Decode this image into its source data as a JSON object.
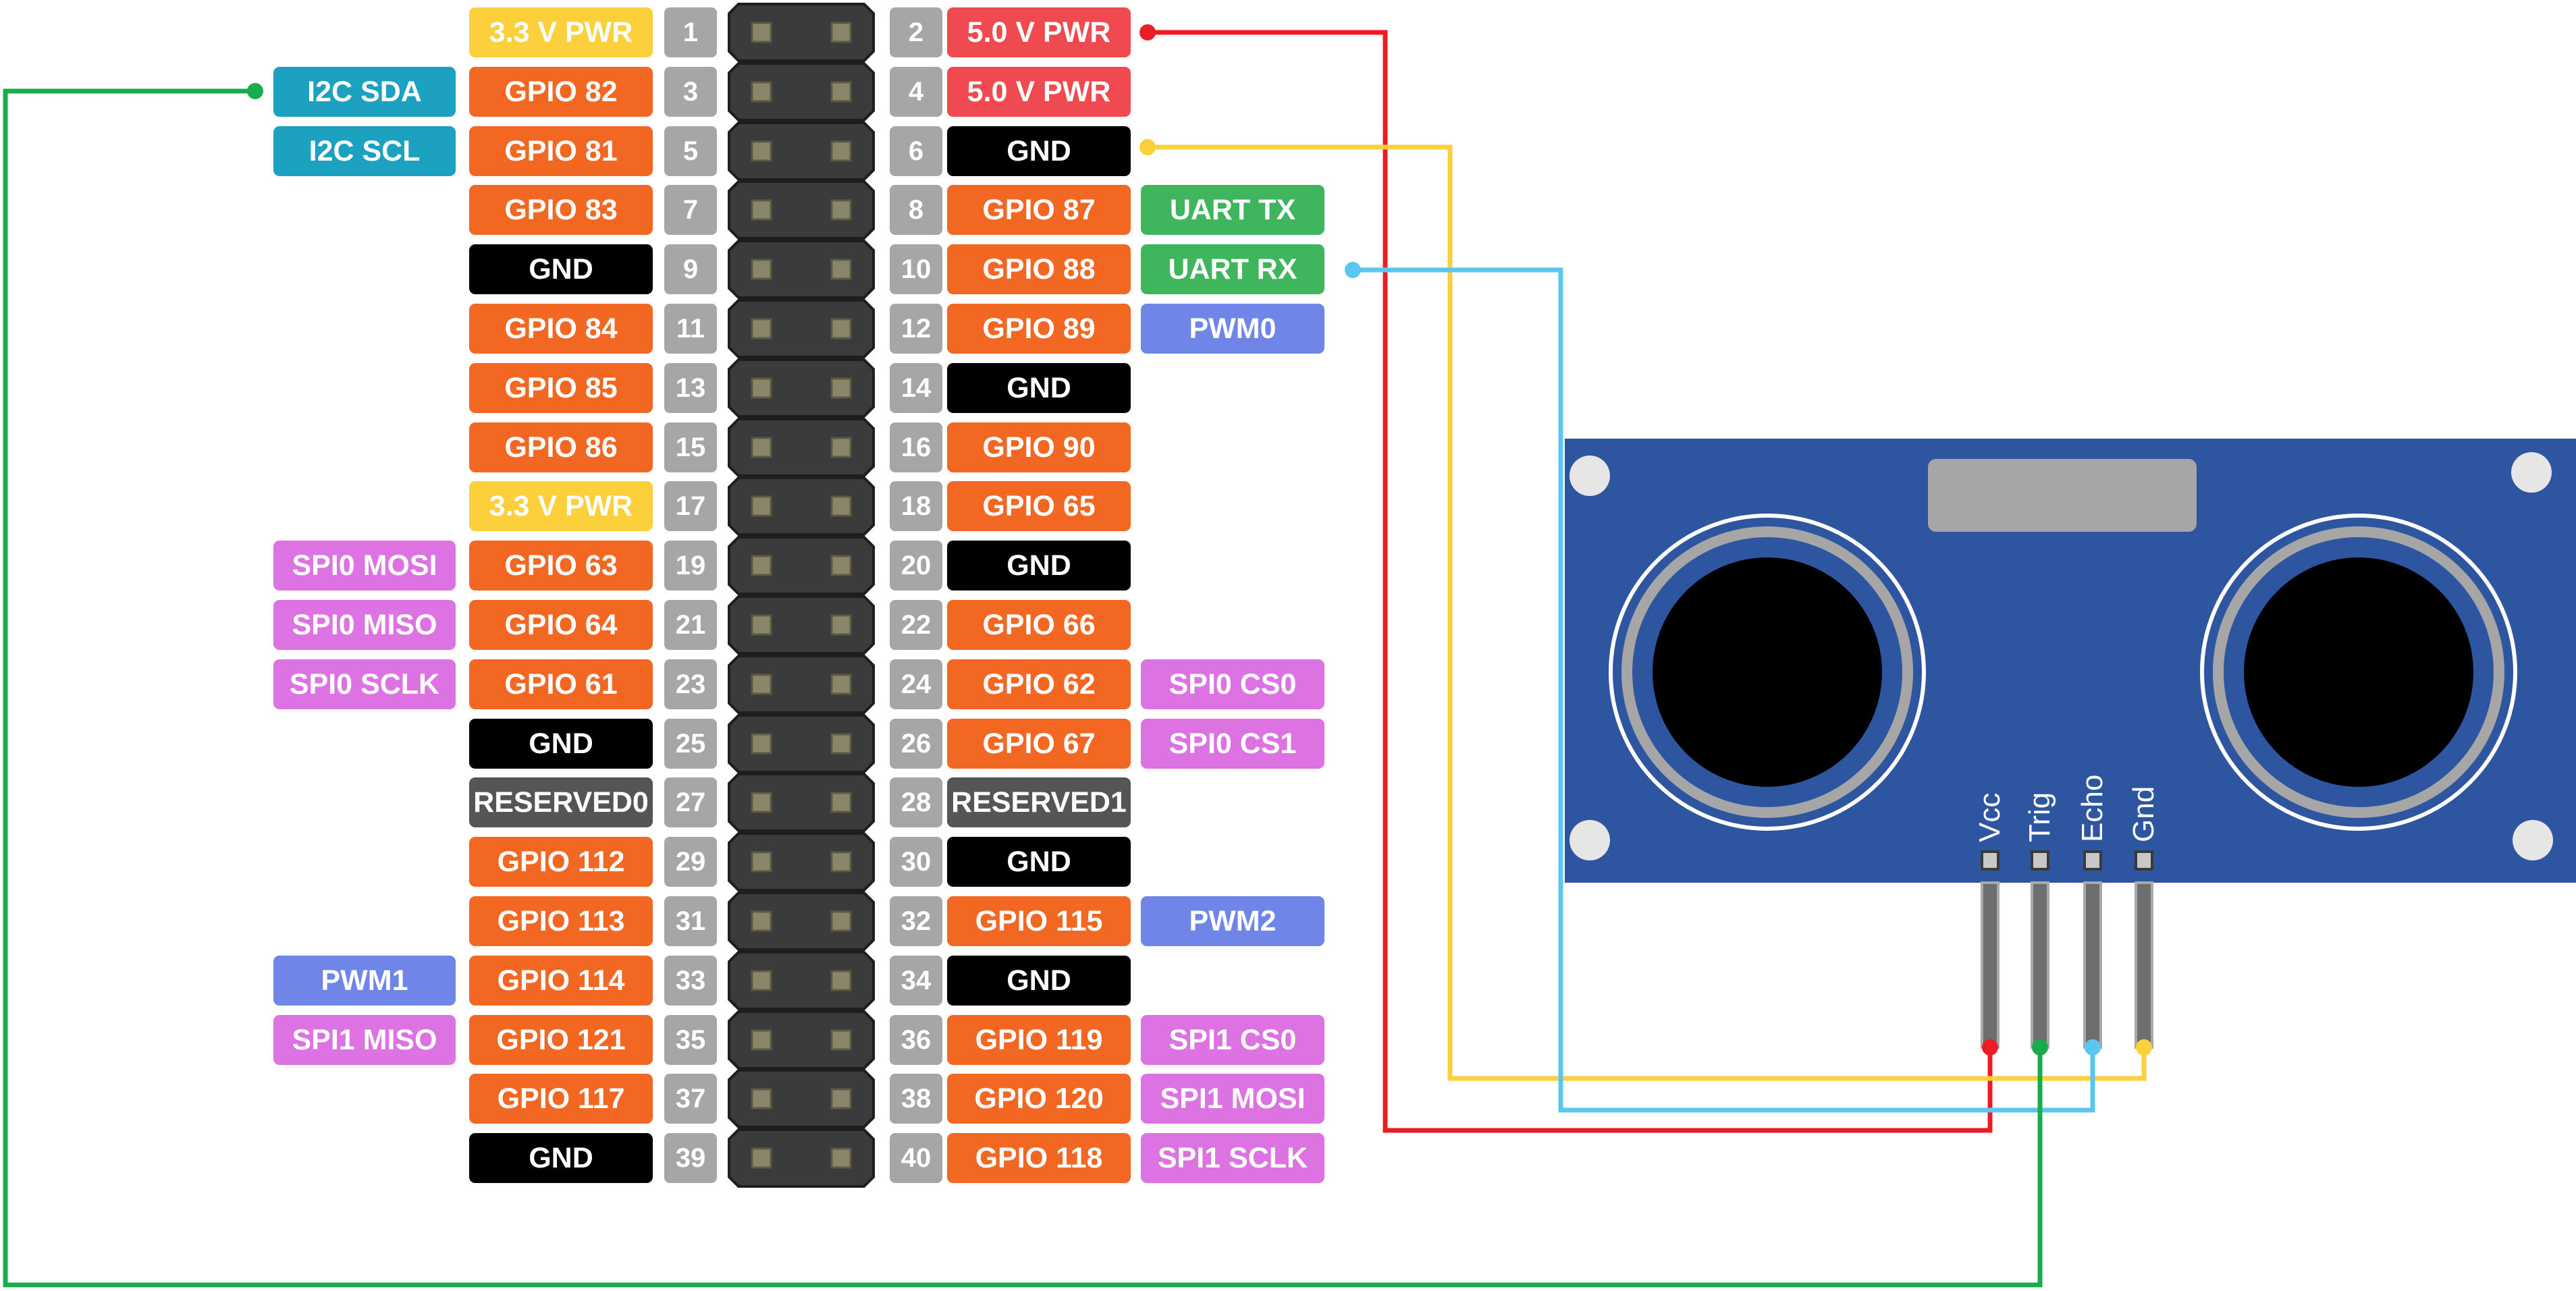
{
  "colors": {
    "pwr33": "#fcd03b",
    "pwr50": "#ef4a4f",
    "gpio": "#f26722",
    "gnd": "#000000",
    "reserved": "#555555",
    "i2c": "#1ca1c1",
    "uart": "#3fb55d",
    "pwm": "#6f85e8",
    "spi": "#dd72e2",
    "pin_number": "#a6a6a6",
    "wire_vcc": "#ec1c24",
    "wire_trig": "#1aab4c",
    "wire_echo": "#5bc6ef",
    "wire_gnd": "#fcd03b",
    "sensor_board": "#2e55a0"
  },
  "header": {
    "rows": [
      {
        "left_num": "1",
        "right_num": "2",
        "left_label": "3.3 V PWR",
        "left_kind": "pwr33",
        "right_label": "5.0 V PWR",
        "right_kind": "pwr50",
        "left_func": "",
        "left_func_kind": "",
        "right_func": "",
        "right_func_kind": ""
      },
      {
        "left_num": "3",
        "right_num": "4",
        "left_label": "GPIO 82",
        "left_kind": "gpio",
        "right_label": "5.0 V PWR",
        "right_kind": "pwr50",
        "left_func": "I2C SDA",
        "left_func_kind": "i2c",
        "right_func": "",
        "right_func_kind": ""
      },
      {
        "left_num": "5",
        "right_num": "6",
        "left_label": "GPIO 81",
        "left_kind": "gpio",
        "right_label": "GND",
        "right_kind": "gnd",
        "left_func": "I2C SCL",
        "left_func_kind": "i2c",
        "right_func": "",
        "right_func_kind": ""
      },
      {
        "left_num": "7",
        "right_num": "8",
        "left_label": "GPIO 83",
        "left_kind": "gpio",
        "right_label": "GPIO 87",
        "right_kind": "gpio",
        "left_func": "",
        "left_func_kind": "",
        "right_func": "UART TX",
        "right_func_kind": "uart"
      },
      {
        "left_num": "9",
        "right_num": "10",
        "left_label": "GND",
        "left_kind": "gnd",
        "right_label": "GPIO 88",
        "right_kind": "gpio",
        "left_func": "",
        "left_func_kind": "",
        "right_func": "UART RX",
        "right_func_kind": "uart"
      },
      {
        "left_num": "11",
        "right_num": "12",
        "left_label": "GPIO 84",
        "left_kind": "gpio",
        "right_label": "GPIO 89",
        "right_kind": "gpio",
        "left_func": "",
        "left_func_kind": "",
        "right_func": "PWM0",
        "right_func_kind": "pwm"
      },
      {
        "left_num": "13",
        "right_num": "14",
        "left_label": "GPIO 85",
        "left_kind": "gpio",
        "right_label": "GND",
        "right_kind": "gnd",
        "left_func": "",
        "left_func_kind": "",
        "right_func": "",
        "right_func_kind": ""
      },
      {
        "left_num": "15",
        "right_num": "16",
        "left_label": "GPIO 86",
        "left_kind": "gpio",
        "right_label": "GPIO 90",
        "right_kind": "gpio",
        "left_func": "",
        "left_func_kind": "",
        "right_func": "",
        "right_func_kind": ""
      },
      {
        "left_num": "17",
        "right_num": "18",
        "left_label": "3.3 V PWR",
        "left_kind": "pwr33",
        "right_label": "GPIO 65",
        "right_kind": "gpio",
        "left_func": "",
        "left_func_kind": "",
        "right_func": "",
        "right_func_kind": ""
      },
      {
        "left_num": "19",
        "right_num": "20",
        "left_label": "GPIO 63",
        "left_kind": "gpio",
        "right_label": "GND",
        "right_kind": "gnd",
        "left_func": "SPI0 MOSI",
        "left_func_kind": "spi",
        "right_func": "",
        "right_func_kind": ""
      },
      {
        "left_num": "21",
        "right_num": "22",
        "left_label": "GPIO 64",
        "left_kind": "gpio",
        "right_label": "GPIO 66",
        "right_kind": "gpio",
        "left_func": "SPI0 MISO",
        "left_func_kind": "spi",
        "right_func": "",
        "right_func_kind": ""
      },
      {
        "left_num": "23",
        "right_num": "24",
        "left_label": "GPIO 61",
        "left_kind": "gpio",
        "right_label": "GPIO 62",
        "right_kind": "gpio",
        "left_func": "SPI0 SCLK",
        "left_func_kind": "spi",
        "right_func": "SPI0 CS0",
        "right_func_kind": "spi"
      },
      {
        "left_num": "25",
        "right_num": "26",
        "left_label": "GND",
        "left_kind": "gnd",
        "right_label": "GPIO 67",
        "right_kind": "gpio",
        "left_func": "",
        "left_func_kind": "",
        "right_func": "SPI0 CS1",
        "right_func_kind": "spi"
      },
      {
        "left_num": "27",
        "right_num": "28",
        "left_label": "RESERVED0",
        "left_kind": "reserved",
        "right_label": "RESERVED1",
        "right_kind": "reserved",
        "left_func": "",
        "left_func_kind": "",
        "right_func": "",
        "right_func_kind": ""
      },
      {
        "left_num": "29",
        "right_num": "30",
        "left_label": "GPIO 112",
        "left_kind": "gpio",
        "right_label": "GND",
        "right_kind": "gnd",
        "left_func": "",
        "left_func_kind": "",
        "right_func": "",
        "right_func_kind": ""
      },
      {
        "left_num": "31",
        "right_num": "32",
        "left_label": "GPIO 113",
        "left_kind": "gpio",
        "right_label": "GPIO 115",
        "right_kind": "gpio",
        "left_func": "",
        "left_func_kind": "",
        "right_func": "PWM2",
        "right_func_kind": "pwm"
      },
      {
        "left_num": "33",
        "right_num": "34",
        "left_label": "GPIO 114",
        "left_kind": "gpio",
        "right_label": "GND",
        "right_kind": "gnd",
        "left_func": "PWM1",
        "left_func_kind": "pwm",
        "right_func": "",
        "right_func_kind": ""
      },
      {
        "left_num": "35",
        "right_num": "36",
        "left_label": "GPIO 121",
        "left_kind": "gpio",
        "right_label": "GPIO 119",
        "right_kind": "gpio",
        "left_func": "SPI1 MISO",
        "left_func_kind": "spi",
        "right_func": "SPI1 CS0",
        "right_func_kind": "spi"
      },
      {
        "left_num": "37",
        "right_num": "38",
        "left_label": "GPIO 117",
        "left_kind": "gpio",
        "right_label": "GPIO 120",
        "right_kind": "gpio",
        "left_func": "",
        "left_func_kind": "",
        "right_func": "SPI1 MOSI",
        "right_func_kind": "spi"
      },
      {
        "left_num": "39",
        "right_num": "40",
        "left_label": "GND",
        "left_kind": "gnd",
        "right_label": "GPIO 118",
        "right_kind": "gpio",
        "left_func": "",
        "left_func_kind": "",
        "right_func": "SPI1 SCLK",
        "right_func_kind": "spi"
      }
    ]
  },
  "sensor": {
    "pins": [
      "Vcc",
      "Trig",
      "Echo",
      "Gnd"
    ]
  },
  "wires": [
    {
      "name": "vcc-wire",
      "from": "5.0 V PWR",
      "to": "Vcc",
      "color_key": "wire_vcc"
    },
    {
      "name": "gnd-wire",
      "from": "GND",
      "to": "Gnd",
      "color_key": "wire_gnd"
    },
    {
      "name": "echo-wire",
      "from": "UART RX",
      "to": "Echo",
      "color_key": "wire_echo"
    },
    {
      "name": "trig-wire",
      "from": "I2C SDA",
      "to": "Trig",
      "color_key": "wire_trig"
    }
  ]
}
